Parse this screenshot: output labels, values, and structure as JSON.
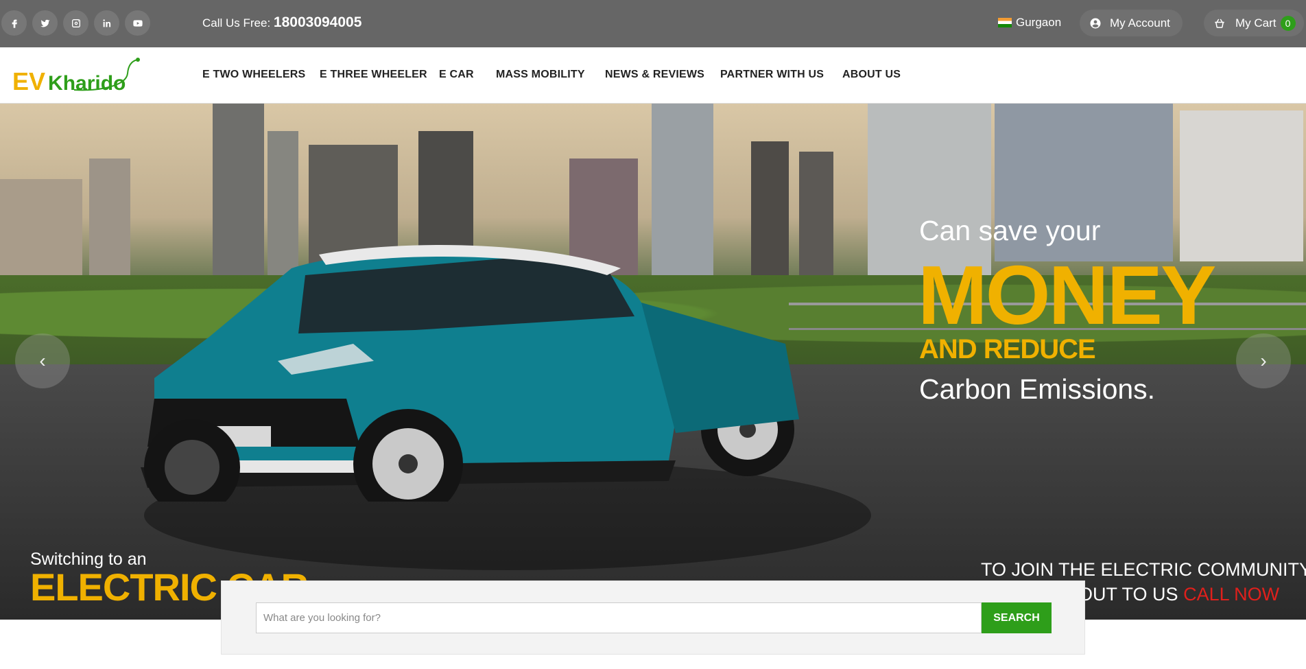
{
  "topbar": {
    "social": [
      {
        "name": "facebook-icon"
      },
      {
        "name": "twitter-icon"
      },
      {
        "name": "instagram-icon"
      },
      {
        "name": "linkedin-icon"
      },
      {
        "name": "youtube-icon"
      }
    ],
    "call_label": "Call Us Free:",
    "call_number": "18003094005",
    "location": "Gurgaon",
    "account_label": "My Account",
    "cart_label": "My Cart",
    "cart_count": "0"
  },
  "logo": {
    "ev": "EV",
    "kharido": "Kharido"
  },
  "nav": {
    "items": [
      {
        "label": "E TWO WHEELERS"
      },
      {
        "label": "E THREE WHEELER"
      },
      {
        "label": "E CAR"
      },
      {
        "label": "MASS MOBILITY"
      },
      {
        "label": "NEWS & REVIEWS"
      },
      {
        "label": "PARTNER WITH US"
      },
      {
        "label": "ABOUT US"
      }
    ]
  },
  "hero": {
    "line1": "Can save your",
    "line2": "MONEY",
    "line3": "AND REDUCE",
    "line4": "Carbon Emissions.",
    "left_small": "Switching to an",
    "left_big": "ELECTRIC CAR",
    "right_line1": "TO JOIN THE ELECTRIC COMMUNITY,",
    "right_line2_pre": "REACH OUT TO US",
    "right_line2_cta": "CALL NOW",
    "colors": {
      "accent": "#f0b100",
      "brand_green": "#2e9e1a",
      "cta_red": "#e0201c"
    }
  },
  "search": {
    "placeholder": "What are you looking for?",
    "value": "",
    "button": "SEARCH"
  }
}
